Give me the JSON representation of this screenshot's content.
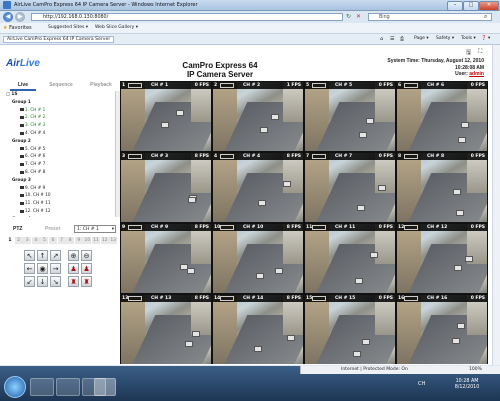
{
  "window": {
    "title": "AirLive CamPro Express 64 IP Camera Server - Windows Internet Explorer"
  },
  "address": {
    "url": "http://192.168.0.130:8080/",
    "search_placeholder": "Bing"
  },
  "favorites": {
    "label": "Favorites",
    "items": [
      "Suggested Sites ▾",
      "Web Slice Gallery ▾"
    ]
  },
  "tab": {
    "label": "AirLive CamPro Express 64 IP Camera Server"
  },
  "toolbar": {
    "page": "Page ▾",
    "safety": "Safety ▾",
    "tools": "Tools ▾",
    "help": "❓ ▾"
  },
  "header": {
    "logo_main": "Air",
    "logo_accent": "Live",
    "product_line1": "CamPro Express 64",
    "product_line2": "IP Camera Server",
    "system_time_label": "System Time:",
    "system_date": "Thursday, August 12, 2010",
    "system_time": "10:28:08 AM",
    "user_label": "User:",
    "user_name": "admin"
  },
  "tabs": {
    "live": "Live",
    "sequence": "Sequence",
    "playback": "Playback"
  },
  "tree": {
    "root": "□ 1S",
    "groups": [
      {
        "name": "Group 1",
        "cams": [
          "1. CH # 1",
          "2. CH # 2",
          "3. CH # 3",
          "4. CH # 4"
        ]
      },
      {
        "name": "Group 2",
        "cams": [
          "5. CH # 5",
          "6. CH # 6",
          "7. CH # 7",
          "8. CH # 8"
        ]
      },
      {
        "name": "Group 3",
        "cams": [
          "9. CH # 9",
          "10. CH # 10",
          "11. CH # 11",
          "12. CH # 12"
        ]
      },
      {
        "name": "Group 4",
        "cams": [
          "13. CH # 13"
        ]
      }
    ]
  },
  "ptz": {
    "label": "PTZ",
    "preset_label": "Preset",
    "selected_channel": "1: CH # 1",
    "pages": [
      "1",
      "2",
      "3",
      "4",
      "5",
      "6",
      "7",
      "8",
      "9",
      "10",
      "11",
      "12",
      "13"
    ]
  },
  "cameras": [
    {
      "num": "1",
      "name": "CH # 1",
      "fps": "0 FPS"
    },
    {
      "num": "2",
      "name": "CH # 2",
      "fps": "1 FPS"
    },
    {
      "num": "5",
      "name": "CH # 5",
      "fps": "0 FPS"
    },
    {
      "num": "6",
      "name": "CH # 6",
      "fps": "0 FPS"
    },
    {
      "num": "3",
      "name": "CH # 3",
      "fps": "8 FPS"
    },
    {
      "num": "4",
      "name": "CH # 4",
      "fps": "8 FPS"
    },
    {
      "num": "7",
      "name": "CH # 7",
      "fps": "0 FPS"
    },
    {
      "num": "8",
      "name": "CH # 8",
      "fps": "0 FPS"
    },
    {
      "num": "9",
      "name": "CH # 9",
      "fps": "8 FPS"
    },
    {
      "num": "10",
      "name": "CH # 10",
      "fps": "8 FPS"
    },
    {
      "num": "11",
      "name": "CH # 11",
      "fps": "0 FPS"
    },
    {
      "num": "12",
      "name": "CH # 12",
      "fps": "0 FPS"
    },
    {
      "num": "13",
      "name": "CH # 13",
      "fps": "8 FPS"
    },
    {
      "num": "14",
      "name": "CH # 14",
      "fps": "8 FPS"
    },
    {
      "num": "15",
      "name": "CH # 15",
      "fps": "0 FPS"
    },
    {
      "num": "16",
      "name": "CH # 16",
      "fps": "0 FPS"
    }
  ],
  "status": {
    "zone": "Internet | Protected Mode: On",
    "zoom": "100%"
  },
  "taskbar": {
    "lang": "CH",
    "time": "10:28 AM",
    "date": "8/12/2010"
  }
}
